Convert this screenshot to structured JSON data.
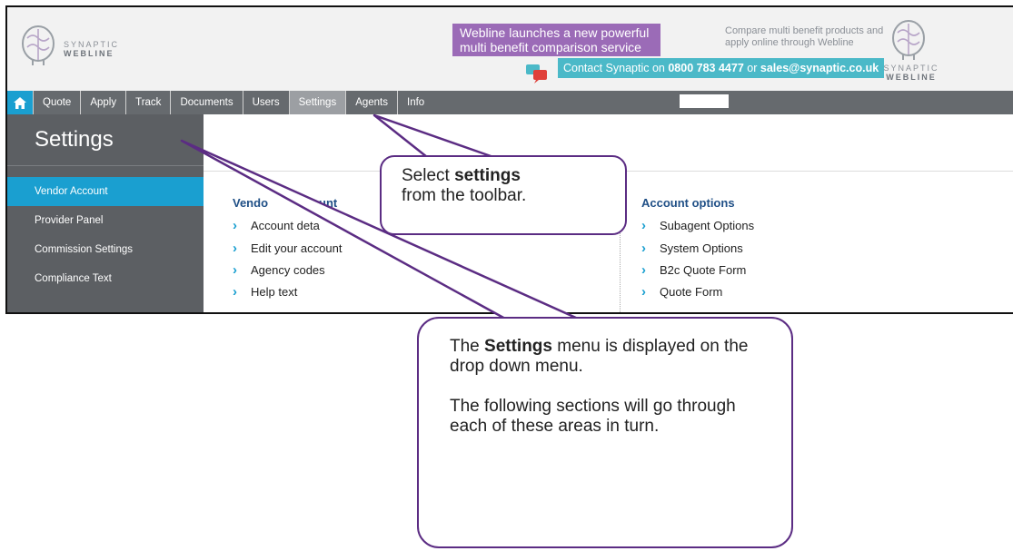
{
  "header": {
    "logo_left_top": "SYNAPTIC",
    "logo_left_bottom": "WEBLINE",
    "promo": "Webline launches a new powerful multi benefit comparison service",
    "contact_prefix": "Contact Synaptic on",
    "contact_phone": "0800 783 4477",
    "contact_or": "or",
    "contact_email": "sales@synaptic.co.uk",
    "compare_text": "Compare multi benefit products and apply online through Webline",
    "logo_right_top": "SYNAPTIC",
    "logo_right_bottom": "WEBLINE"
  },
  "toolbar": {
    "home_icon": "home-icon",
    "items": [
      "Quote",
      "Apply",
      "Track",
      "Documents",
      "Users",
      "Settings",
      "Agents",
      "Info"
    ],
    "active": "Settings"
  },
  "sidebar": {
    "title": "Settings",
    "items": [
      "Vendor Account",
      "Provider Panel",
      "Commission Settings",
      "Compliance Text"
    ],
    "active": "Vendor Account"
  },
  "content": {
    "vendor_title_start": "Vendo",
    "vendor_title_end": "unt",
    "vendor_links": [
      "Account deta",
      "Edit your account",
      "Agency codes",
      "Help text"
    ],
    "options_title": "Account options",
    "options_links": [
      "Subagent Options",
      "System Options",
      "B2c Quote Form",
      "Quote Form"
    ]
  },
  "callouts": {
    "one_pre": "Select",
    "one_bold": "settings",
    "one_post": "from the toolbar.",
    "two_pre": "The",
    "two_bold": "Settings",
    "two_post": "menu is displayed on the drop down menu.",
    "two_para2": "The following sections will go through each of these areas in turn."
  },
  "colors": {
    "accent_blue": "#1a9fd0",
    "promo_purple": "#9b6bb7",
    "contact_teal": "#4bb9c8",
    "callout_border": "#5b2c83",
    "toolbar_gray": "#666a6e",
    "sidebar_gray": "#5c5f63",
    "section_title": "#1f4f86"
  }
}
